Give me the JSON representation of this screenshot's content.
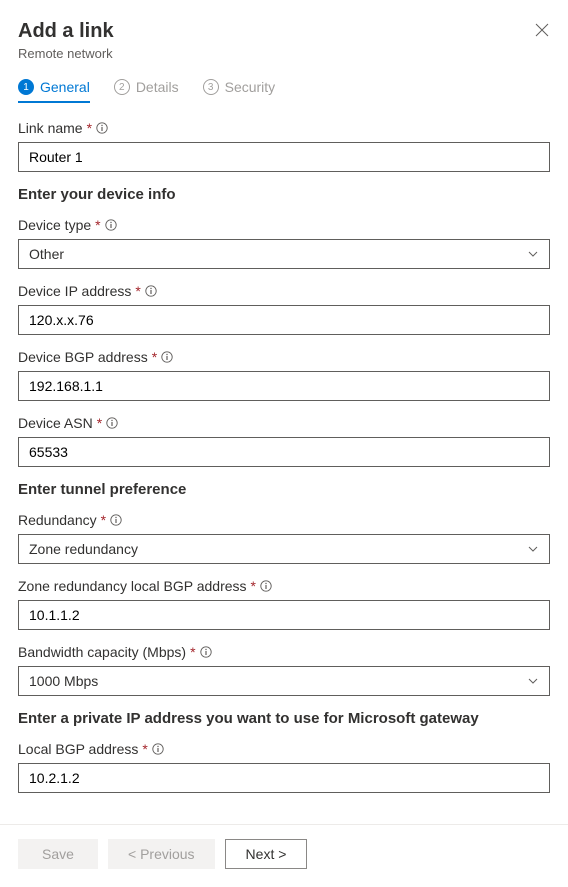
{
  "header": {
    "title": "Add a link",
    "subtitle": "Remote network"
  },
  "tabs": [
    {
      "num": "1",
      "label": "General",
      "active": true
    },
    {
      "num": "2",
      "label": "Details",
      "active": false
    },
    {
      "num": "3",
      "label": "Security",
      "active": false
    }
  ],
  "sections": {
    "device_info": "Enter your device info",
    "tunnel_pref": "Enter tunnel preference",
    "private_ip": "Enter a private IP address you want to use for Microsoft gateway"
  },
  "fields": {
    "link_name": {
      "label": "Link name",
      "value": "Router 1"
    },
    "device_type": {
      "label": "Device type",
      "value": "Other"
    },
    "device_ip": {
      "label": "Device IP address",
      "value": "120.x.x.76"
    },
    "device_bgp": {
      "label": "Device BGP address",
      "value": "192.168.1.1"
    },
    "device_asn": {
      "label": "Device ASN",
      "value": "65533"
    },
    "redundancy": {
      "label": "Redundancy",
      "value": "Zone redundancy"
    },
    "zone_local_bgp": {
      "label": "Zone redundancy local BGP address",
      "value": "10.1.1.2"
    },
    "bandwidth": {
      "label": "Bandwidth capacity (Mbps)",
      "value": "1000 Mbps"
    },
    "local_bgp": {
      "label": "Local BGP address",
      "value": "10.2.1.2"
    }
  },
  "footer": {
    "save": "Save",
    "previous": "< Previous",
    "next": "Next >"
  },
  "required_mark": "*"
}
